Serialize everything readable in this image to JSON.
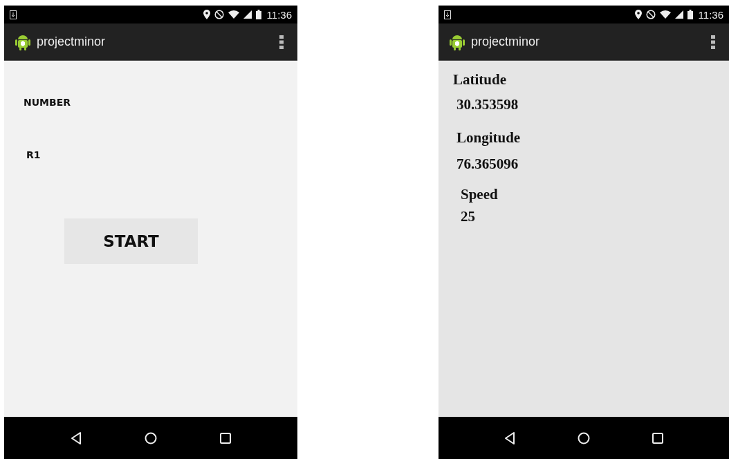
{
  "screens": [
    {
      "kind": "form",
      "time": "11:36",
      "title": "projectminor",
      "labels": [
        "NUMBER",
        "R1"
      ],
      "button": "START"
    },
    {
      "kind": "readings",
      "time": "11:36",
      "title": "projectminor",
      "lines": [
        "Latitude",
        "30.353598",
        "Longitude",
        "76.365096",
        "Speed",
        "25"
      ]
    }
  ]
}
